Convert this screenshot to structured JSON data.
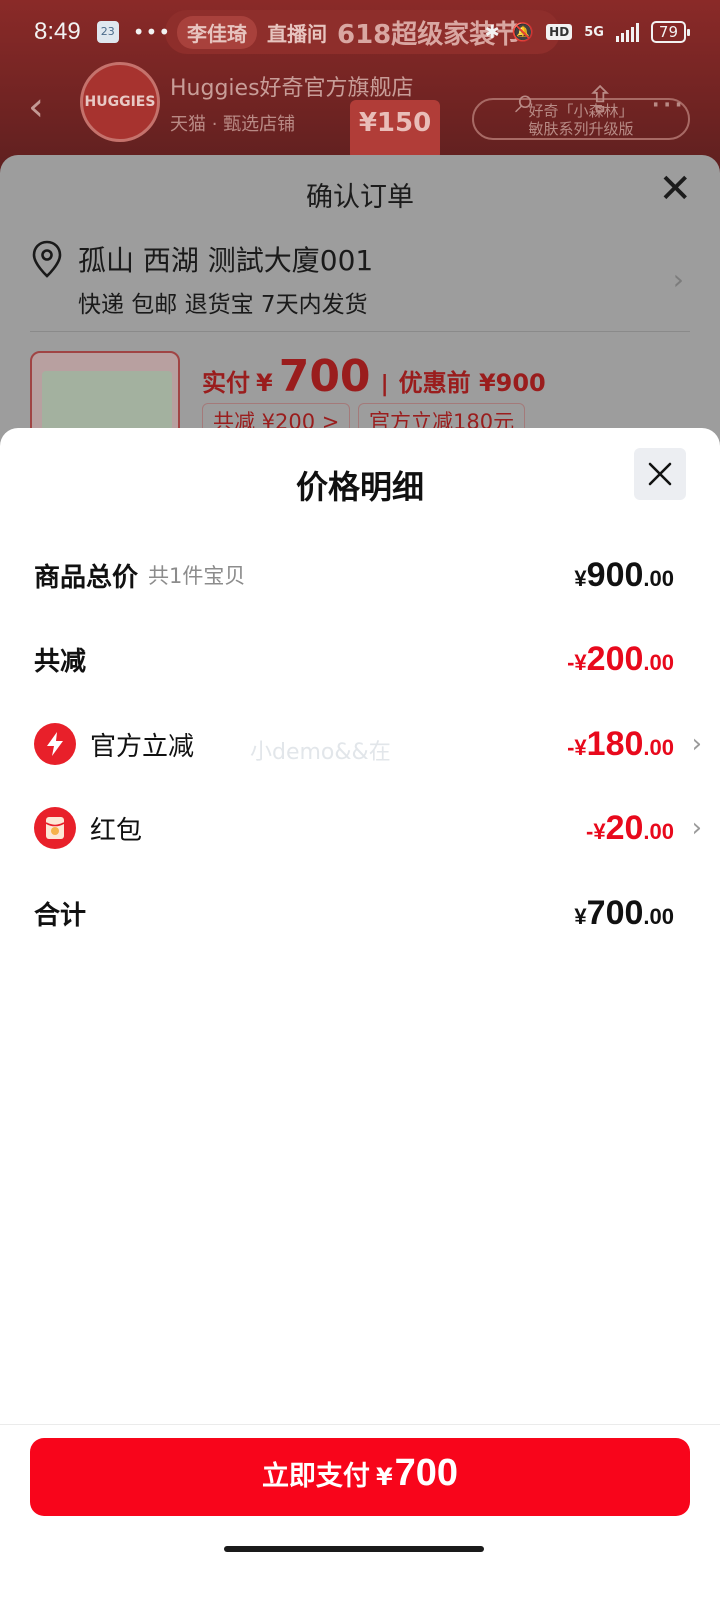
{
  "status_bar": {
    "time": "8:49",
    "calendar_day": "23",
    "dots": "•••",
    "network": "5G",
    "hd": "HD",
    "battery": "79"
  },
  "store": {
    "live_host": "李佳琦",
    "live_tag": "直播间",
    "live_title": "618超级家装节",
    "logo_text": "HUGGIES",
    "name": "Huggies好奇官方旗舰店",
    "subtitle": "天猫 · 甄选店铺",
    "promo_value": "¥150",
    "pill_line1": "好奇「小森林」",
    "pill_line2": "敏肤系列升级版"
  },
  "order": {
    "title": "确认订单",
    "address_name": "孤山 西湖 测試大廈001",
    "address_meta": "快递 包邮 退货宝 7天内发货",
    "pay_label": "实付",
    "pay_currency": "¥",
    "pay_amount": "700",
    "pay_separator": "|",
    "before_discount": "优惠前 ¥900",
    "chip_total_discount": "共减 ¥200 >",
    "chip_official": "官方立减180元"
  },
  "detail": {
    "title": "价格明细",
    "watermark": "小demo&&在",
    "rows": {
      "subtotal": {
        "label": "商品总价",
        "sub": "共1件宝贝",
        "yen": "¥",
        "int": "900",
        "dec": ".00"
      },
      "total_discount": {
        "label": "共减",
        "yen": "-¥",
        "int": "200",
        "dec": ".00"
      },
      "official_discount": {
        "label": "官方立减",
        "yen": "-¥",
        "int": "180",
        "dec": ".00",
        "icon": "lightning-icon"
      },
      "red_packet": {
        "label": "红包",
        "yen": "-¥",
        "int": "20",
        "dec": ".00",
        "icon": "red-packet-icon"
      },
      "total": {
        "label": "合计",
        "yen": "¥",
        "int": "700",
        "dec": ".00"
      }
    }
  },
  "pay_button": {
    "label": "立即支付",
    "currency": "¥",
    "amount": "700"
  },
  "colors": {
    "accent_red": "#f8051b",
    "price_red": "#e8091c",
    "icon_red": "#e8202a"
  }
}
